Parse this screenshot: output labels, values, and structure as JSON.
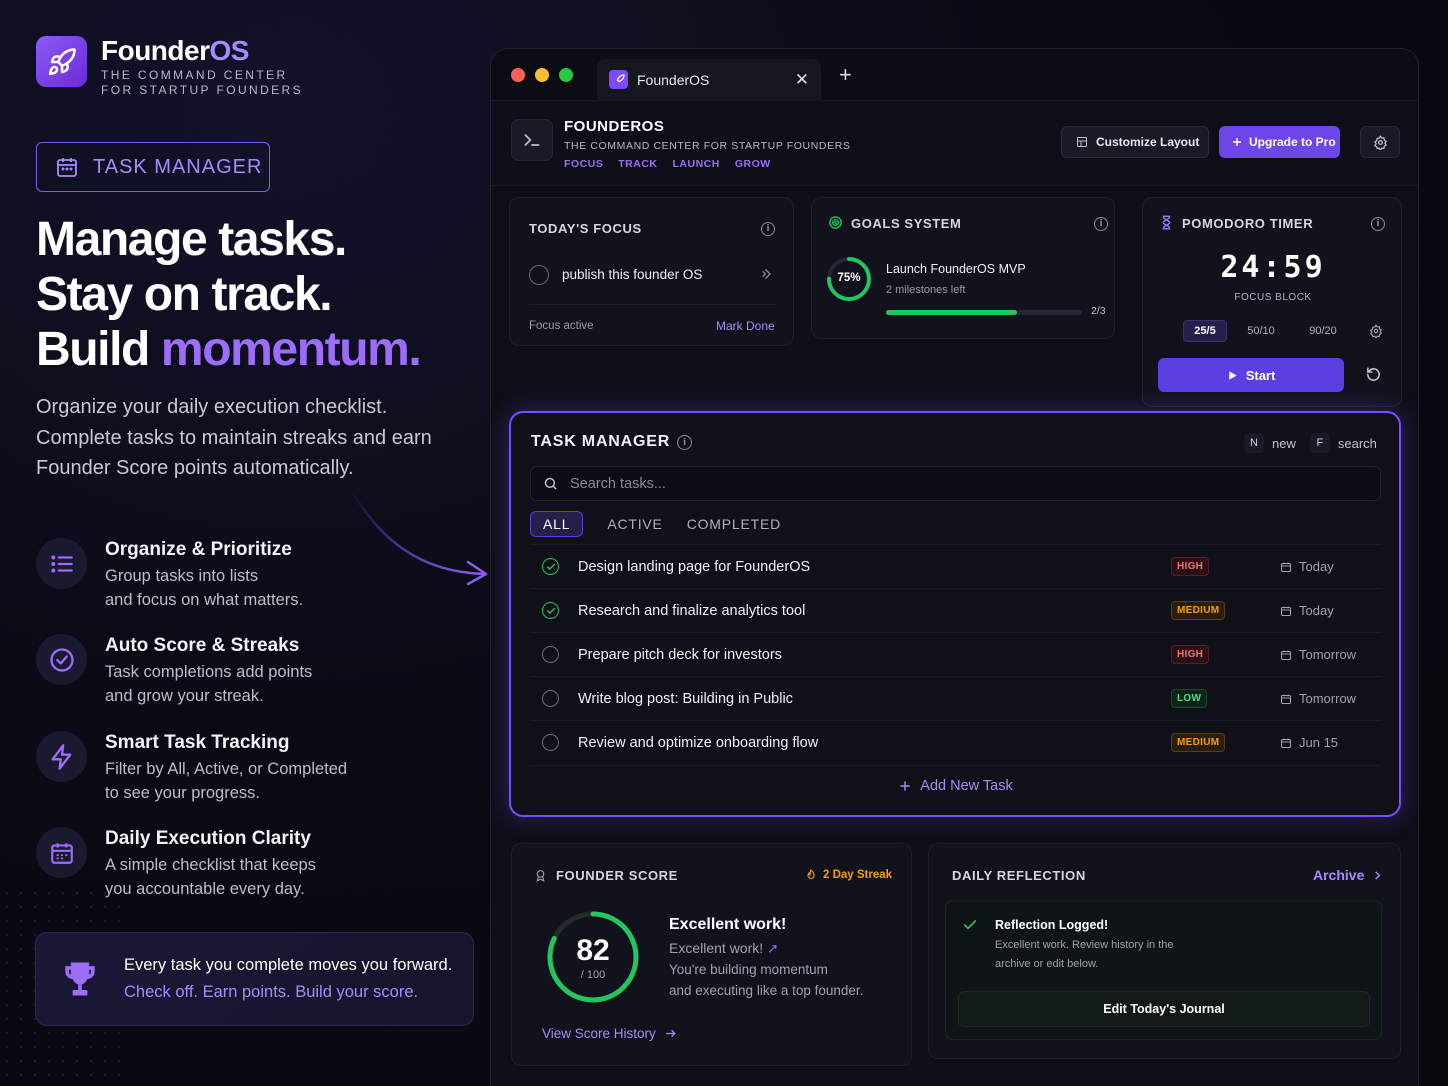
{
  "brand": {
    "name_main": "Founder",
    "name_accent": "OS",
    "tagline_1": "THE COMMAND CENTER",
    "tagline_2": "FOR STARTUP FOUNDERS"
  },
  "badge": {
    "label": "TASK MANAGER"
  },
  "headline": {
    "line1": "Manage tasks.",
    "line2": "Stay on track.",
    "line3_prefix": "Build ",
    "line3_accent": "momentum."
  },
  "intro": "Organize your daily execution checklist. Complete tasks to maintain streaks and earn Founder Score points automatically.",
  "features": [
    {
      "icon": "list-icon",
      "title": "Organize & Prioritize",
      "line1": "Group tasks into lists",
      "line2": "and focus on what matters."
    },
    {
      "icon": "check-circle-icon",
      "title": "Auto Score & Streaks",
      "line1": "Task completions add points",
      "line2": "and grow your streak."
    },
    {
      "icon": "lightning-icon",
      "title": "Smart Task Tracking",
      "line1": "Filter by All, Active, or Completed",
      "line2": "to see your progress."
    },
    {
      "icon": "calendar-icon",
      "title": "Daily Execution Clarity",
      "line1": "A simple checklist that keeps",
      "line2": "you accountable every day."
    }
  ],
  "cta": {
    "line1": "Every task you complete moves you forward.",
    "line2": "Check off. Earn points. Build your score."
  },
  "window": {
    "tab_title": "FounderOS",
    "close_glyph": "✕",
    "newtab_glyph": "+",
    "app_title": "FOUNDEROS",
    "app_subtitle": "THE COMMAND CENTER FOR STARTUP FOUNDERS",
    "nav": [
      "FOCUS",
      "TRACK",
      "LAUNCH",
      "GROW"
    ],
    "customize_label": "Customize Layout",
    "upgrade_label": "Upgrade to Pro"
  },
  "focus": {
    "title": "TODAY'S FOCUS",
    "task": "publish this founder OS",
    "status": "Focus active",
    "action": "Mark Done"
  },
  "goals": {
    "title": "GOALS SYSTEM",
    "percent_label": "75%",
    "percent": 0.75,
    "goal": "Launch FounderOS MVP",
    "sub": "2 milestones left",
    "progress_label": "2/3",
    "progress": 0.667
  },
  "pomodoro": {
    "title": "POMODORO TIMER",
    "time": "24:59",
    "mode": "FOCUS BLOCK",
    "presets": [
      "25/5",
      "50/10",
      "90/20"
    ],
    "start_label": "Start"
  },
  "task_manager": {
    "title": "TASK MANAGER",
    "shortcut_new_key": "N",
    "shortcut_new_label": "new",
    "shortcut_search_key": "F",
    "shortcut_search_label": "search",
    "search_placeholder": "Search tasks...",
    "filters": [
      "ALL",
      "ACTIVE",
      "COMPLETED"
    ],
    "tasks": [
      {
        "title": "Design landing page for FounderOS",
        "priority": "HIGH",
        "due": "Today",
        "done": true
      },
      {
        "title": "Research and finalize analytics tool",
        "priority": "MEDIUM",
        "due": "Today",
        "done": true
      },
      {
        "title": "Prepare pitch deck for investors",
        "priority": "HIGH",
        "due": "Tomorrow",
        "done": false
      },
      {
        "title": "Write blog post: Building in Public",
        "priority": "LOW",
        "due": "Tomorrow",
        "done": false
      },
      {
        "title": "Review and optimize onboarding flow",
        "priority": "MEDIUM",
        "due": "Jun 15",
        "done": false
      }
    ],
    "add_label": "Add New Task"
  },
  "score": {
    "title": "FOUNDER SCORE",
    "streak": "2 Day Streak",
    "value": "82",
    "max": "/ 100",
    "fraction": 0.82,
    "headline": "Excellent work!",
    "line1": "Excellent work!",
    "line2": "You're building momentum",
    "line3": "and executing like a top founder.",
    "history_label": "View Score History"
  },
  "reflection": {
    "title": "DAILY REFLECTION",
    "archive_label": "Archive",
    "logged_title": "Reflection Logged!",
    "logged_line1": "Excellent work. Review history in the",
    "logged_line2": "archive or edit below.",
    "journal_label": "Edit Today's Journal"
  },
  "colors": {
    "accent": "#7c4dff",
    "accent_text": "#a78bfa",
    "success": "#22c55e",
    "high": "#f87171",
    "medium": "#f59e0b",
    "low": "#4ade80"
  }
}
